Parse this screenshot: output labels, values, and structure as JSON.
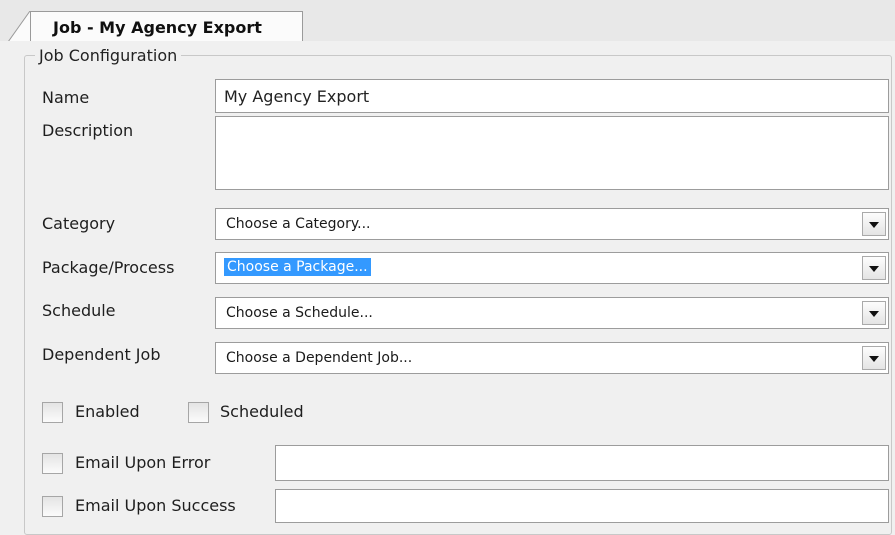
{
  "tab": {
    "title": "Job - My Agency Export"
  },
  "group": {
    "title": "Job Configuration"
  },
  "fields": {
    "name": {
      "label": "Name",
      "value": "My Agency Export"
    },
    "description": {
      "label": "Description",
      "value": ""
    },
    "category": {
      "label": "Category",
      "value": "Choose a Category..."
    },
    "package": {
      "label": "Package/Process",
      "value": "Choose a Package..."
    },
    "schedule": {
      "label": "Schedule",
      "value": "Choose a Schedule..."
    },
    "dependent_job": {
      "label": "Dependent Job",
      "value": "Choose a Dependent Job..."
    }
  },
  "checkboxes": {
    "enabled": {
      "label": "Enabled",
      "checked": false
    },
    "scheduled": {
      "label": "Scheduled",
      "checked": false
    },
    "email_error": {
      "label": "Email Upon Error",
      "checked": false,
      "value": ""
    },
    "email_success": {
      "label": "Email Upon Success",
      "checked": false,
      "value": ""
    }
  },
  "colors": {
    "selection": "#3399ff",
    "background": "#f0f0f0"
  }
}
